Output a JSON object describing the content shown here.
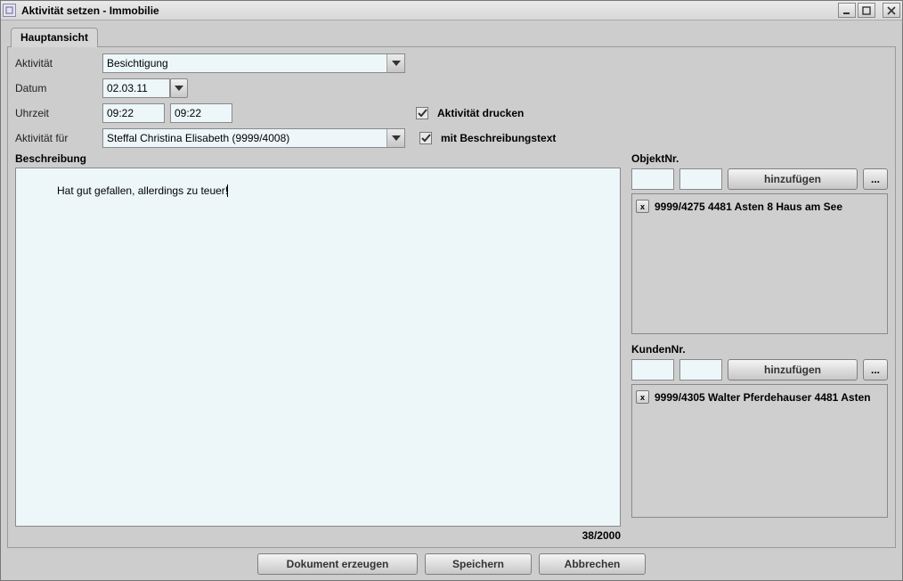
{
  "window": {
    "title": "Aktivität setzen - Immobilie"
  },
  "tab": {
    "main": "Hauptansicht"
  },
  "labels": {
    "aktivitaet": "Aktivität",
    "datum": "Datum",
    "uhrzeit": "Uhrzeit",
    "aktivitaet_fuer": "Aktivität für",
    "beschreibung": "Beschreibung",
    "objektnr": "ObjektNr.",
    "kundennr": "KundenNr."
  },
  "form": {
    "aktivitaet_value": "Besichtigung",
    "datum_value": "02.03.11",
    "uhrzeit_from": "09:22",
    "uhrzeit_to": "09:22",
    "aktivitaet_fuer_value": "Steffal Christina Elisabeth (9999/4008)",
    "beschreibung_text": "Hat gut gefallen, allerdings zu teuer!",
    "counter": "38/2000"
  },
  "checkboxes": {
    "drucken_label": "Aktivität drucken",
    "beschreibung_label": "mit Beschreibungstext",
    "drucken_checked": true,
    "beschreibung_checked": true
  },
  "buttons": {
    "hinzufuegen": "hinzufügen",
    "dots": "...",
    "dok_erzeugen": "Dokument erzeugen",
    "speichern": "Speichern",
    "abbrechen": "Abbrechen"
  },
  "objekt_list": [
    {
      "text": "9999/4275 4481 Asten 8 Haus am See"
    }
  ],
  "kunden_list": [
    {
      "text": "9999/4305 Walter Pferdehauser 4481 Asten"
    }
  ],
  "del_glyph": "x"
}
